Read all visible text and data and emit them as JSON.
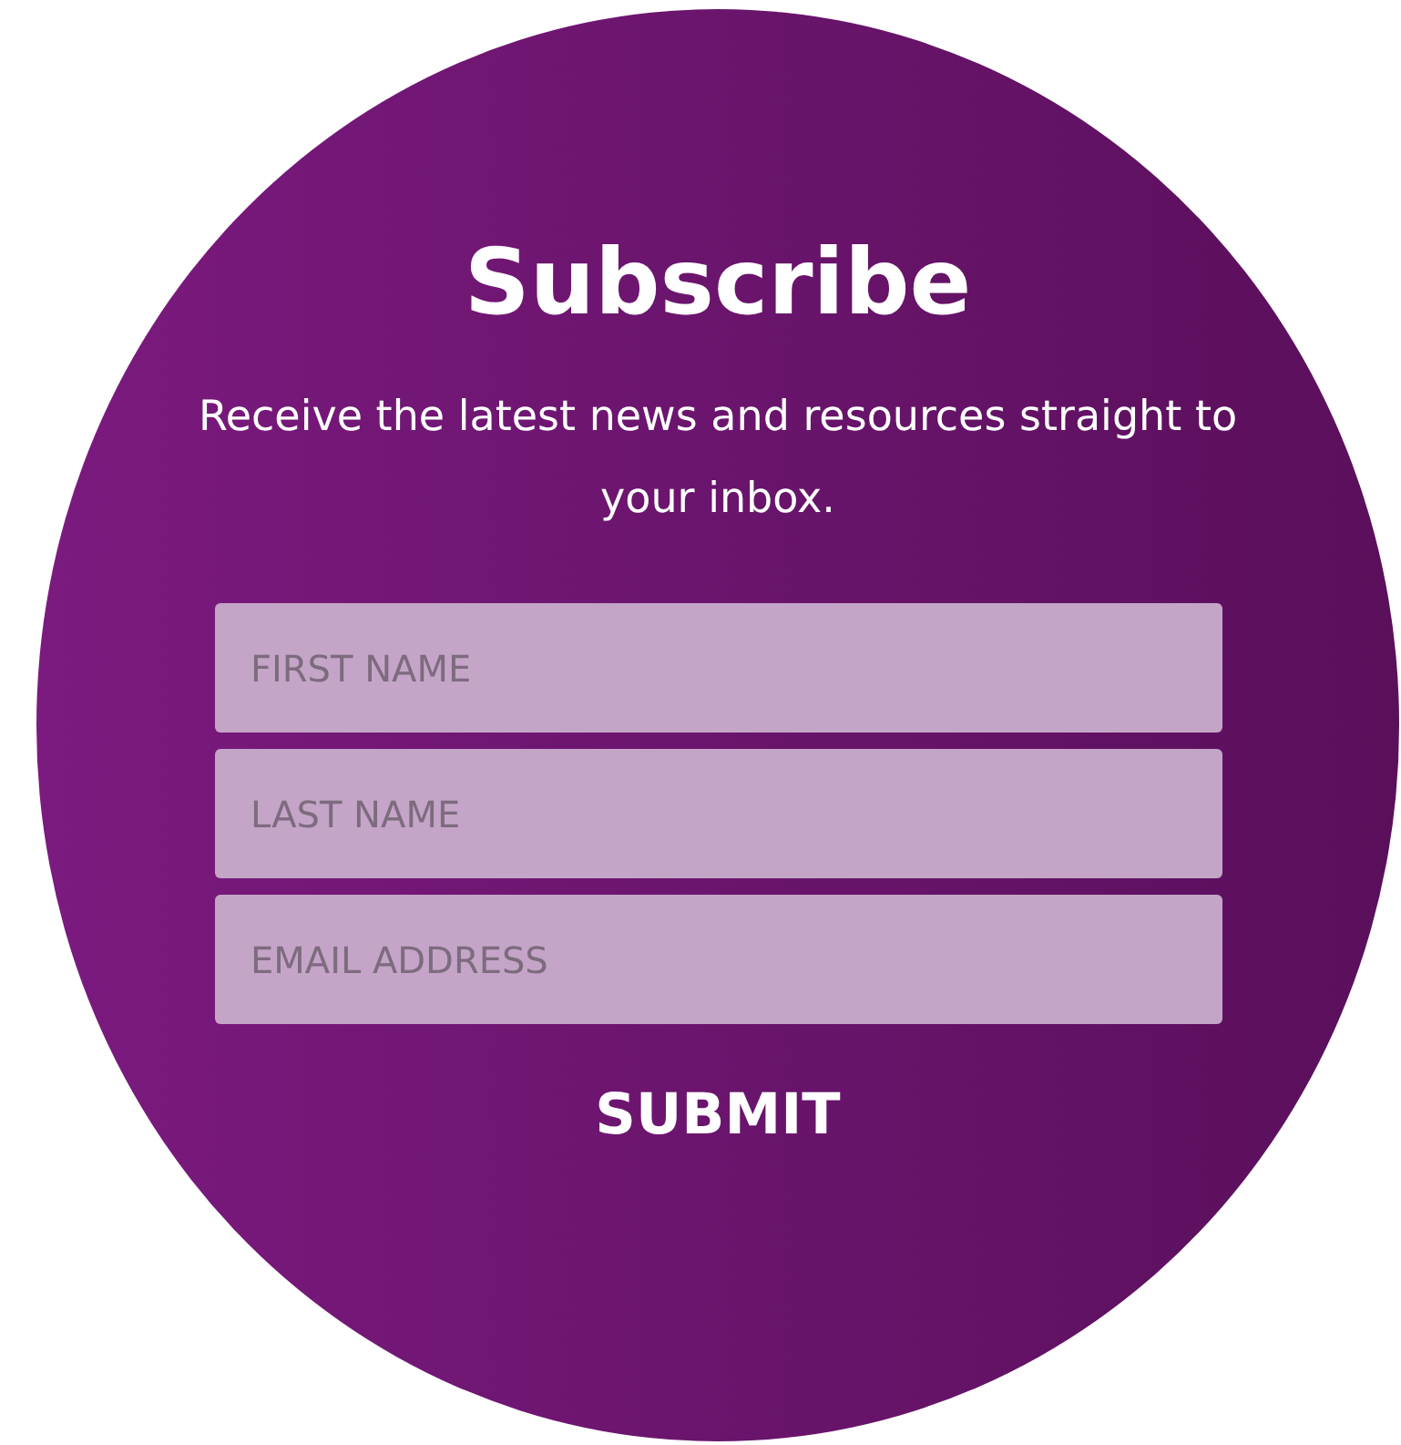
{
  "title": "Subscribe",
  "description": "Receive the latest news and resources straight to your inbox.",
  "fields": [
    {
      "placeholder": "FIRST NAME"
    },
    {
      "placeholder": "LAST NAME"
    },
    {
      "placeholder": "EMAIL ADDRESS"
    }
  ],
  "submit": "SUBMIT"
}
